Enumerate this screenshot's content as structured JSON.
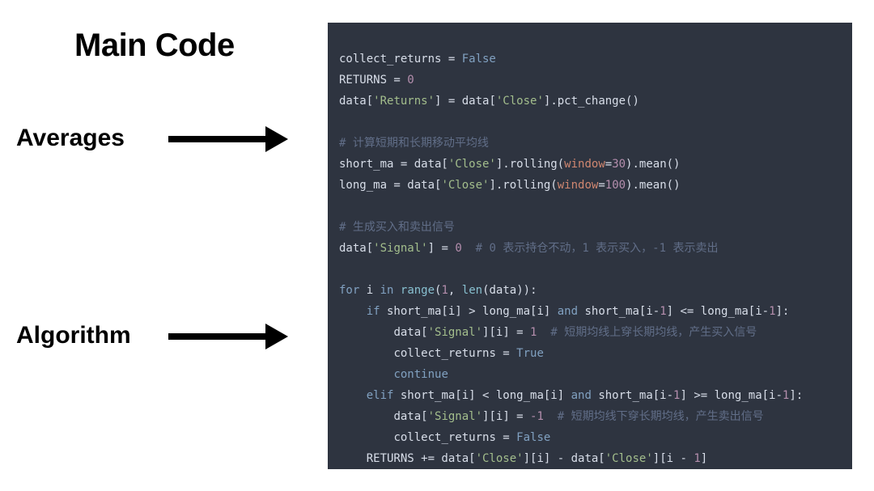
{
  "labels": {
    "title": "Main Code",
    "averages": "Averages",
    "algorithm": "Algorithm"
  },
  "code": {
    "l01": {
      "a": "collect_returns = ",
      "b": "False"
    },
    "l02": {
      "a": "RETURNS = ",
      "b": "0"
    },
    "l03": {
      "a": "data[",
      "s1": "'Returns'",
      "b": "] = data[",
      "s2": "'Close'",
      "c": "].pct_change()"
    },
    "l04": "",
    "l05": "# 计算短期和长期移动平均线",
    "l06": {
      "a": "short_ma = data[",
      "s": "'Close'",
      "b": "].rolling(",
      "n": "window",
      "c": "=",
      "v": "30",
      "d": ").mean()"
    },
    "l07": {
      "a": "long_ma = data[",
      "s": "'Close'",
      "b": "].rolling(",
      "n": "window",
      "c": "=",
      "v": "100",
      "d": ").mean()"
    },
    "l08": "",
    "l09": "# 生成买入和卖出信号",
    "l10": {
      "a": "data[",
      "s": "'Signal'",
      "b": "] = ",
      "v": "0",
      "c": "  # 0 表示持仓不动，1 表示买入，-1 表示卖出"
    },
    "l11": "",
    "l12": {
      "kw1": "for",
      "a": " i ",
      "kw2": "in",
      "b": " ",
      "fn": "range",
      "c": "(",
      "n1": "1",
      "d": ", ",
      "fn2": "len",
      "e": "(data)):"
    },
    "l13": {
      "pad": "    ",
      "kw": "if",
      "a": " short_ma[i] > long_ma[i] ",
      "kw2": "and",
      "b": " short_ma[i-",
      "n": "1",
      "c": "] <= long_ma[i-",
      "n2": "1",
      "d": "]:"
    },
    "l14": {
      "pad": "        ",
      "a": "data[",
      "s": "'Signal'",
      "b": "][i] = ",
      "v": "1",
      "c": "  # 短期均线上穿长期均线，产生买入信号"
    },
    "l15": {
      "pad": "        ",
      "a": "collect_returns = ",
      "b": "True"
    },
    "l16": {
      "pad": "        ",
      "kw": "continue"
    },
    "l17": {
      "pad": "    ",
      "kw": "elif",
      "a": " short_ma[i] < long_ma[i] ",
      "kw2": "and",
      "b": " short_ma[i-",
      "n": "1",
      "c": "] >= long_ma[i-",
      "n2": "1",
      "d": "]:"
    },
    "l18": {
      "pad": "        ",
      "a": "data[",
      "s": "'Signal'",
      "b": "][i] = ",
      "v": "-1",
      "c": "  # 短期均线下穿长期均线，产生卖出信号"
    },
    "l19": {
      "pad": "        ",
      "a": "collect_returns = ",
      "b": "False"
    },
    "l20": {
      "pad": "    ",
      "a": "RETURNS += data[",
      "s1": "'Close'",
      "b": "][i] - data[",
      "s2": "'Close'",
      "c": "][i - ",
      "n": "1",
      "d": "]"
    }
  }
}
